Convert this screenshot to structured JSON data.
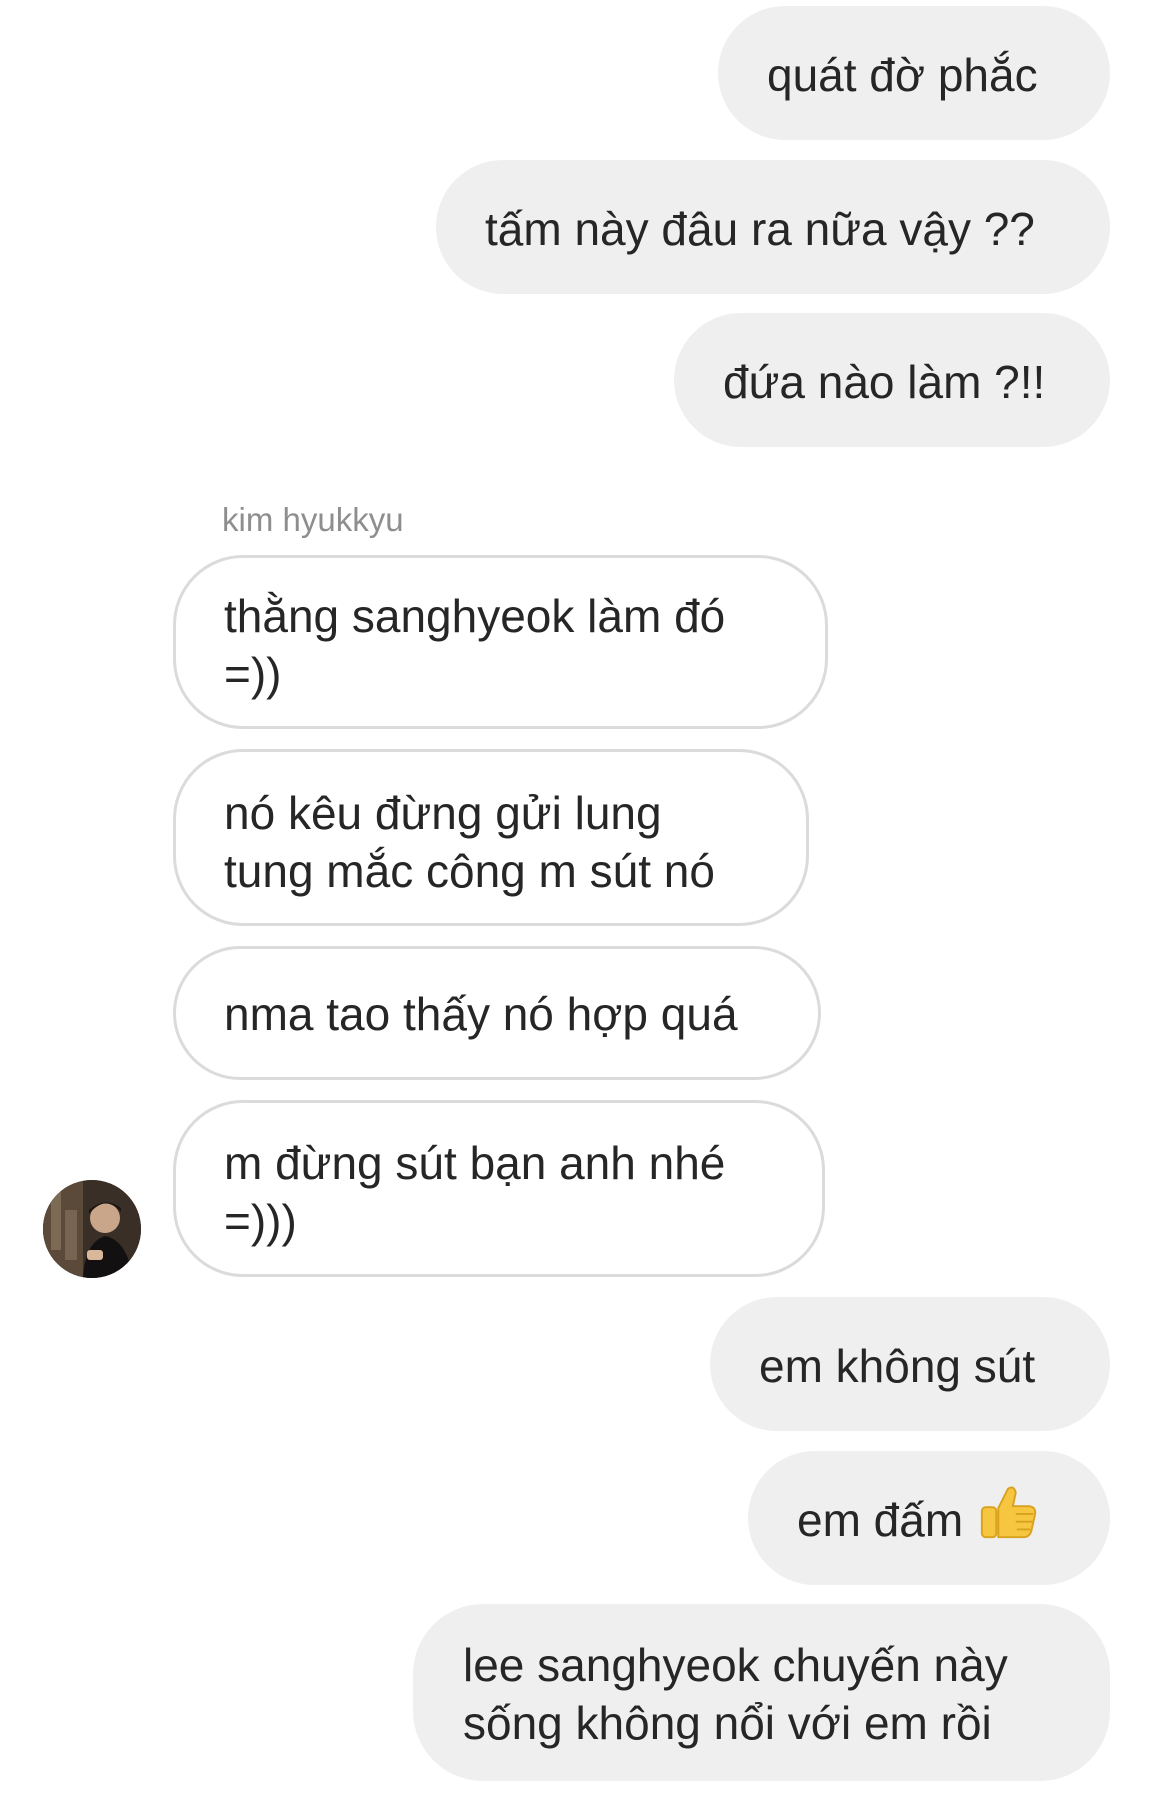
{
  "conversation": {
    "sender_name": "kim hyukkyu",
    "messages": [
      {
        "from": "me",
        "lines": [
          "quát đờ phắc"
        ]
      },
      {
        "from": "me",
        "lines": [
          "tấm này đâu ra nữa vậy ??"
        ]
      },
      {
        "from": "me",
        "lines": [
          "đứa nào làm ?!!"
        ]
      },
      {
        "from": "them",
        "lines": [
          "thằng sanghyeok làm đó",
          "=))"
        ]
      },
      {
        "from": "them",
        "lines": [
          "nó kêu đừng gửi lung",
          "tung mắc công m sút nó"
        ]
      },
      {
        "from": "them",
        "lines": [
          "nma tao thấy nó hợp quá"
        ]
      },
      {
        "from": "them",
        "lines": [
          "m đừng sút bạn anh nhé",
          "=)))"
        ]
      },
      {
        "from": "me",
        "lines": [
          "em không sút"
        ]
      },
      {
        "from": "me",
        "lines": [
          "em đấm"
        ],
        "emoji": "thumbs-up-icon"
      },
      {
        "from": "me",
        "lines": [
          "lee sanghyeok chuyến này",
          "sống không nổi với em rồi"
        ]
      }
    ]
  },
  "colors": {
    "outgoing_bubble": "#efefef",
    "incoming_border": "#dbdbdb",
    "text": "#262626",
    "sender_name": "#8e8e8e",
    "thumbs_up": "#f6c641"
  }
}
